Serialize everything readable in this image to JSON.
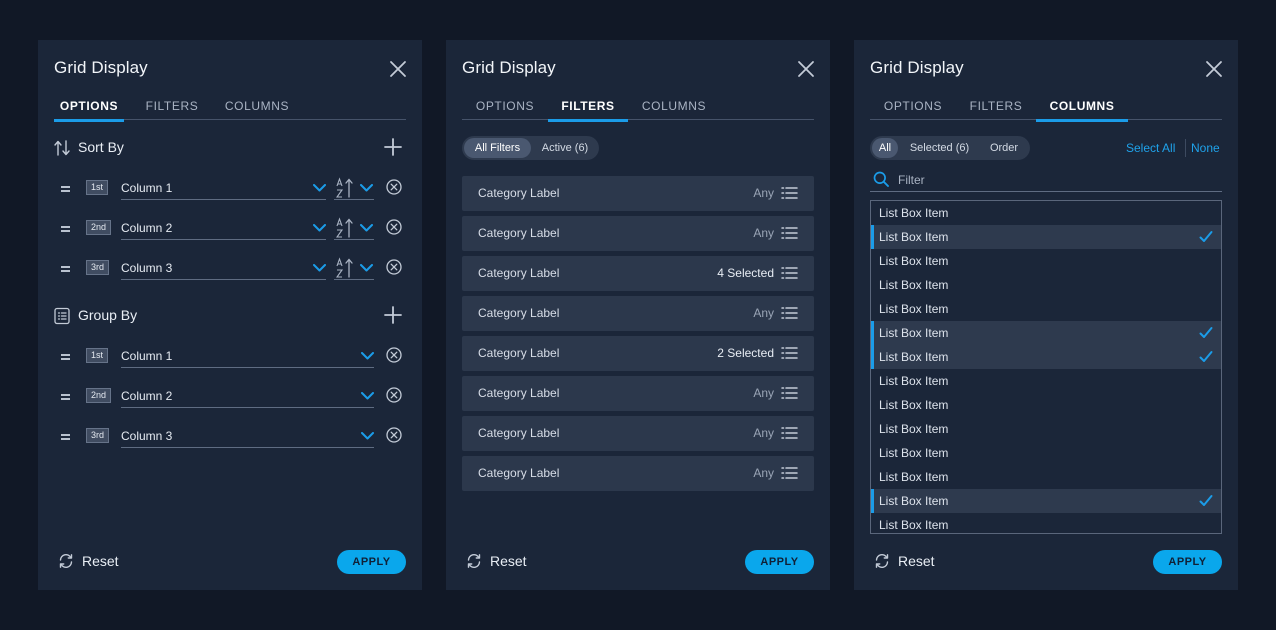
{
  "panels": [
    {
      "title": "Grid Display",
      "tabs": [
        "OPTIONS",
        "FILTERS",
        "COLUMNS"
      ],
      "active_tab": "OPTIONS",
      "sort_by": {
        "label": "Sort By",
        "rows": [
          {
            "order": "1st",
            "column": "Column 1"
          },
          {
            "order": "2nd",
            "column": "Column 2"
          },
          {
            "order": "3rd",
            "column": "Column 3"
          }
        ]
      },
      "group_by": {
        "label": "Group By",
        "rows": [
          {
            "order": "1st",
            "column": "Column 1"
          },
          {
            "order": "2nd",
            "column": "Column 2"
          },
          {
            "order": "3rd",
            "column": "Column 3"
          }
        ]
      },
      "footer": {
        "reset": "Reset",
        "apply": "APPLY"
      }
    },
    {
      "title": "Grid Display",
      "tabs": [
        "OPTIONS",
        "FILTERS",
        "COLUMNS"
      ],
      "active_tab": "FILTERS",
      "segments": [
        "All Filters",
        "Active (6)"
      ],
      "active_segment": "All Filters",
      "filters": [
        {
          "label": "Category Label",
          "value": "Any"
        },
        {
          "label": "Category Label",
          "value": "Any"
        },
        {
          "label": "Category Label",
          "value": "4 Selected"
        },
        {
          "label": "Category Label",
          "value": "Any"
        },
        {
          "label": "Category Label",
          "value": "2 Selected"
        },
        {
          "label": "Category Label",
          "value": "Any"
        },
        {
          "label": "Category Label",
          "value": "Any"
        },
        {
          "label": "Category Label",
          "value": "Any"
        }
      ],
      "footer": {
        "reset": "Reset",
        "apply": "APPLY"
      }
    },
    {
      "title": "Grid Display",
      "tabs": [
        "OPTIONS",
        "FILTERS",
        "COLUMNS"
      ],
      "active_tab": "COLUMNS",
      "segments": [
        "All",
        "Selected (6)",
        "Order"
      ],
      "active_segment": "All",
      "links": {
        "select_all": "Select All",
        "none": "None"
      },
      "search": {
        "placeholder": "Filter",
        "value": ""
      },
      "list_items": [
        {
          "label": "List Box Item",
          "selected": false
        },
        {
          "label": "List Box Item",
          "selected": true
        },
        {
          "label": "List Box Item",
          "selected": false
        },
        {
          "label": "List Box Item",
          "selected": false
        },
        {
          "label": "List Box Item",
          "selected": false
        },
        {
          "label": "List Box Item",
          "selected": true
        },
        {
          "label": "List Box Item",
          "selected": true
        },
        {
          "label": "List Box Item",
          "selected": false
        },
        {
          "label": "List Box Item",
          "selected": false
        },
        {
          "label": "List Box Item",
          "selected": false
        },
        {
          "label": "List Box Item",
          "selected": false
        },
        {
          "label": "List Box Item",
          "selected": false
        },
        {
          "label": "List Box Item",
          "selected": true
        },
        {
          "label": "List Box Item",
          "selected": false
        }
      ],
      "footer": {
        "reset": "Reset",
        "apply": "APPLY"
      }
    }
  ],
  "icons": {
    "close": "close-icon",
    "sort": "sort-arrows-icon",
    "group": "group-list-icon",
    "add": "plus-icon",
    "drag": "drag-handle-icon",
    "chevron": "chevron-down-icon",
    "sort_direction": "sort-az-icon",
    "remove": "remove-circle-icon",
    "reset": "refresh-icon",
    "list": "list-icon",
    "search": "search-icon",
    "check": "checkmark-icon"
  },
  "colors": {
    "page_bg": "#111826",
    "panel_bg": "#1b2639",
    "row_bg": "#2c384c",
    "accent": "#1b9ce8",
    "apply": "#0aa7ec"
  }
}
